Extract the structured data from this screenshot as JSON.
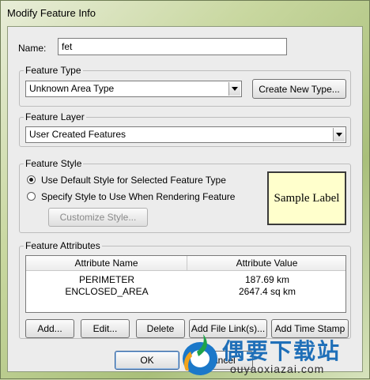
{
  "window": {
    "title": "Modify Feature Info"
  },
  "name_field": {
    "label": "Name:",
    "value": "fet"
  },
  "feature_type": {
    "group_label": "Feature Type",
    "selected": "Unknown Area Type",
    "create_button": "Create New Type..."
  },
  "feature_layer": {
    "group_label": "Feature Layer",
    "selected": "User Created Features"
  },
  "feature_style": {
    "group_label": "Feature Style",
    "option_default": "Use Default Style for Selected Feature Type",
    "option_specify": "Specify Style to Use When Rendering Feature",
    "selected_option": "default",
    "customize_button": "Customize Style...",
    "sample_label": "Sample Label"
  },
  "feature_attributes": {
    "group_label": "Feature Attributes",
    "columns": [
      "Attribute Name",
      "Attribute Value"
    ],
    "rows": [
      {
        "name": "PERIMETER",
        "value": "187.69 km"
      },
      {
        "name": "ENCLOSED_AREA",
        "value": "2647.4 sq km"
      }
    ],
    "buttons": {
      "add": "Add...",
      "edit": "Edit...",
      "delete": "Delete",
      "add_file_link": "Add File Link(s)...",
      "add_time_stamp": "Add Time Stamp"
    }
  },
  "footer": {
    "ok": "OK",
    "cancel": "Cancel"
  },
  "watermark": {
    "brand": "偶要下载站",
    "url": "ouyaoxiazai.com"
  }
}
